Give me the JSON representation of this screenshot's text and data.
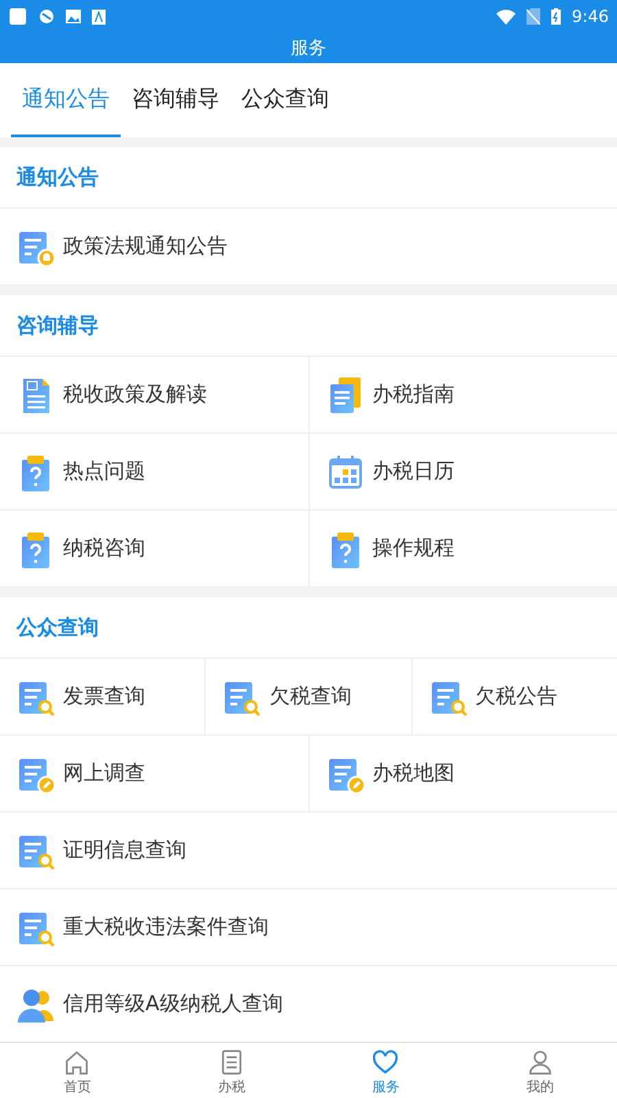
{
  "status_bar": {
    "time": "9:46"
  },
  "header": {
    "title": "服务"
  },
  "tabs": [
    {
      "label": "通知公告",
      "selected": true
    },
    {
      "label": "咨询辅导",
      "selected": false
    },
    {
      "label": "公众查询",
      "selected": false
    }
  ],
  "sections": [
    {
      "title": "通知公告",
      "rows": [
        [
          {
            "label": "政策法规通知公告",
            "kind": "doc-bell"
          }
        ]
      ]
    },
    {
      "title": "咨询辅导",
      "rows": [
        [
          {
            "label": "税收政策及解读",
            "kind": "tax-doc"
          },
          {
            "label": "办税指南",
            "kind": "stack-doc"
          }
        ],
        [
          {
            "label": "热点问题",
            "kind": "clipboard"
          },
          {
            "label": "办税日历",
            "kind": "calendar"
          }
        ],
        [
          {
            "label": "纳税咨询",
            "kind": "clipboard"
          },
          {
            "label": "操作规程",
            "kind": "clipboard"
          }
        ]
      ]
    },
    {
      "title": "公众查询",
      "rows": [
        [
          {
            "label": "发票查询",
            "kind": "doc-search"
          },
          {
            "label": "欠税查询",
            "kind": "doc-search"
          },
          {
            "label": "欠税公告",
            "kind": "doc-search"
          }
        ],
        [
          {
            "label": "网上调查",
            "kind": "doc-pencil"
          },
          {
            "label": "办税地图",
            "kind": "doc-pencil"
          }
        ],
        [
          {
            "label": "证明信息查询",
            "kind": "doc-search"
          }
        ],
        [
          {
            "label": "重大税收违法案件查询",
            "kind": "doc-search"
          }
        ],
        [
          {
            "label": "信用等级A级纳税人查询",
            "kind": "people"
          }
        ]
      ]
    }
  ],
  "bottom_nav": [
    {
      "label": "首页",
      "kind": "home",
      "selected": false
    },
    {
      "label": "办税",
      "kind": "list",
      "selected": false
    },
    {
      "label": "服务",
      "kind": "heart",
      "selected": true
    },
    {
      "label": "我的",
      "kind": "person",
      "selected": false
    }
  ]
}
